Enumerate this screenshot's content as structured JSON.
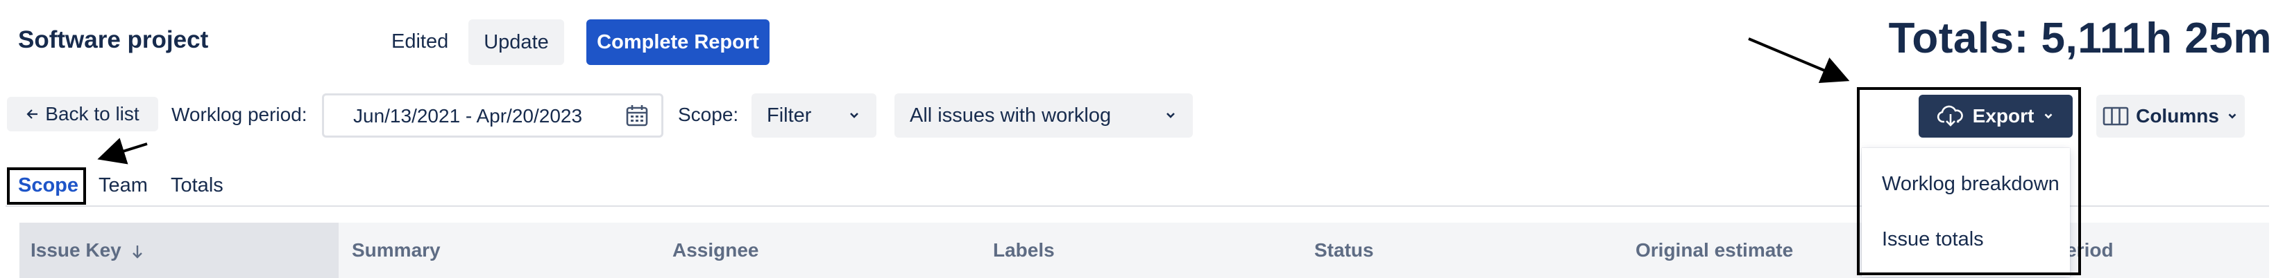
{
  "header": {
    "project_title": "Software project",
    "edited_label": "Edited",
    "update_label": "Update",
    "complete_report_label": "Complete Report",
    "totals_text": "Totals: 5,111h 25m"
  },
  "toolbar": {
    "back_label": "Back to list",
    "worklog_period_label": "Worklog period:",
    "worklog_period_value": "Jun/13/2021 - Apr/20/2023",
    "scope_label": "Scope:",
    "scope_filter_value": "Filter",
    "issues_filter_value": "All issues with worklog",
    "export_label": "Export",
    "columns_label": "Columns"
  },
  "tabs": [
    {
      "label": "Scope",
      "active": true
    },
    {
      "label": "Team",
      "active": false
    },
    {
      "label": "Totals",
      "active": false
    }
  ],
  "table": {
    "columns": [
      "Issue Key",
      "Summary",
      "Assignee",
      "Labels",
      "Status",
      "Original estimate",
      "period"
    ]
  },
  "export_menu": {
    "items": [
      "Worklog breakdown",
      "Issue totals"
    ]
  },
  "colors": {
    "primary": "#1e55c8",
    "dark_button": "#253858",
    "text": "#172b4d",
    "muted_text": "#5e6c84",
    "subtle_bg": "#f1f2f4",
    "annotation": "#000000"
  },
  "icons": [
    "calendar-icon",
    "chevron-down-icon",
    "cloud-download-icon",
    "columns-icon",
    "arrow-left-icon",
    "arrow-down-icon"
  ]
}
